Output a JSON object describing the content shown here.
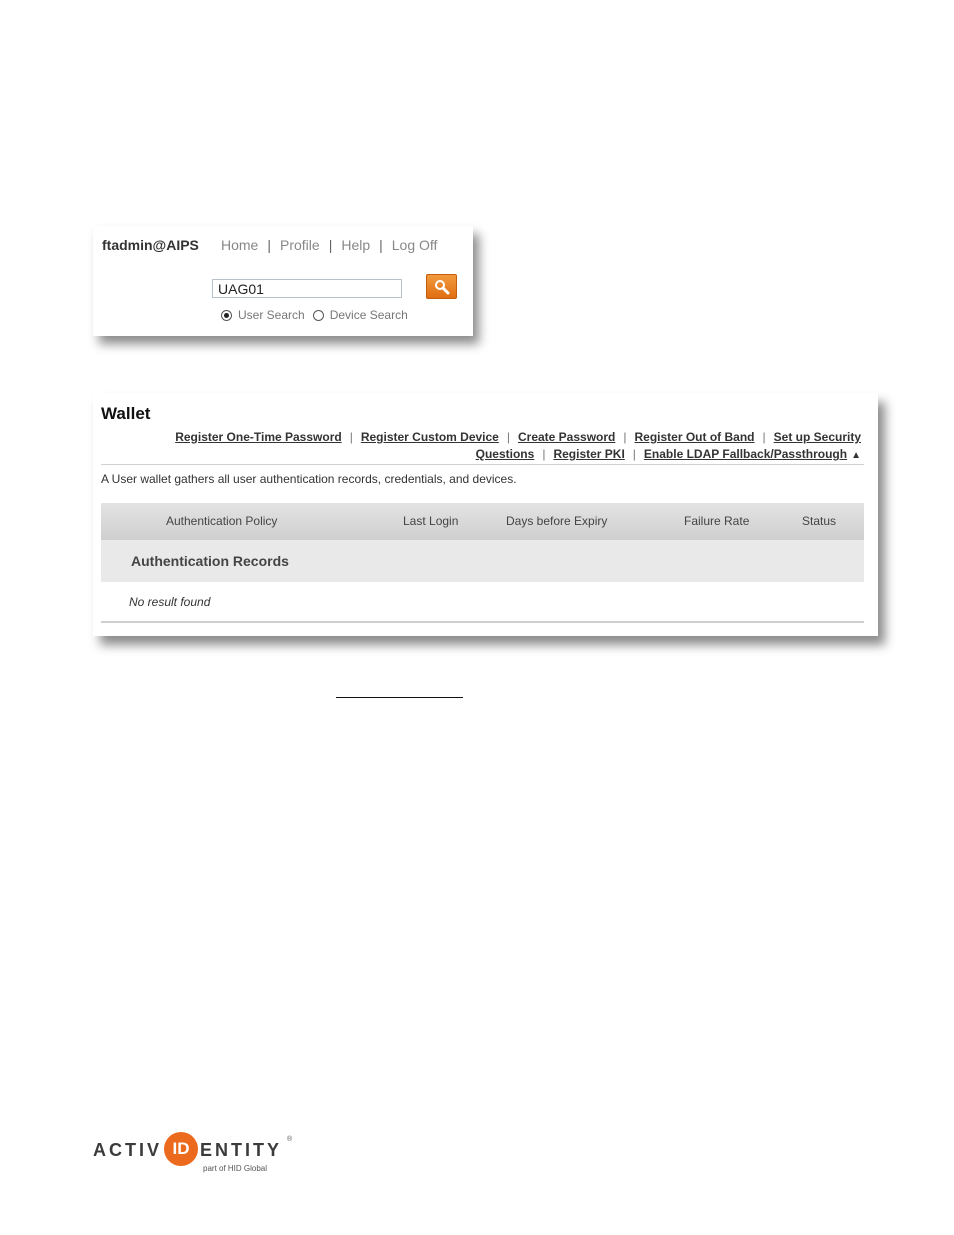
{
  "header": {
    "user": "ftadmin@AIPS",
    "nav": [
      {
        "label": "Home"
      },
      {
        "label": "Profile"
      },
      {
        "label": "Help"
      },
      {
        "label": "Log Off"
      }
    ],
    "separator": "|"
  },
  "search": {
    "value": "UAG01",
    "button_icon": "search-icon",
    "options": [
      {
        "label": "User Search",
        "checked": true
      },
      {
        "label": "Device Search",
        "checked": false
      }
    ]
  },
  "wallet": {
    "title": "Wallet",
    "actions_line1": [
      "Register One-Time Password",
      "Register Custom Device",
      "Create Password",
      "Register Out of Band",
      "Set up Security"
    ],
    "actions_line2": [
      "Questions",
      "Register PKI",
      "Enable LDAP Fallback/Passthrough"
    ],
    "collapse_icon": "▲",
    "description": "A User wallet gathers all user authentication records, credentials, and devices.",
    "columns": [
      "Authentication Policy",
      "Last Login",
      "Days before Expiry",
      "Failure Rate",
      "Status"
    ],
    "section_label": "Authentication Records",
    "empty_text": "No result found"
  },
  "logo": {
    "brand_left": "ACTIV",
    "brand_id": "ID",
    "brand_right": "ENTITY",
    "registered": "®",
    "tagline": "part of HID Global"
  },
  "colors": {
    "accent_orange": "#ec6a1e",
    "header_gray": "#d9d9d9",
    "section_gray": "#e9e9e9"
  }
}
